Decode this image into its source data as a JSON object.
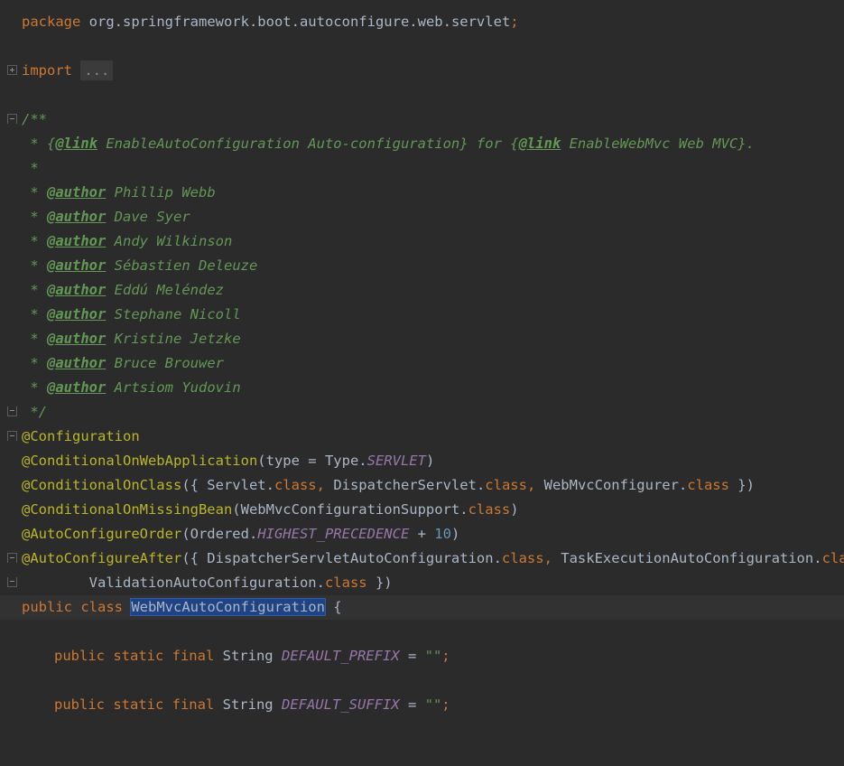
{
  "editor": {
    "package_keyword": "package",
    "package_name": "org.springframework.boot.autoconfigure.web.servlet",
    "semicolon": ";",
    "import_keyword": "import",
    "import_folded": "...",
    "javadoc": {
      "open": "/**",
      "line1_prefix": " * {",
      "line1_link1": "@link",
      "line1_text1": " EnableAutoConfiguration Auto-configuration} for {",
      "line1_link2": "@link",
      "line1_text2": " EnableWebMvc Web MVC}.",
      "blank": " *",
      "author_tag": "@author",
      "star": " * ",
      "authors": [
        "Phillip Webb",
        "Dave Syer",
        "Andy Wilkinson",
        "Sébastien Deleuze",
        "Eddú Meléndez",
        "Stephane Nicoll",
        "Kristine Jetzke",
        "Bruce Brouwer",
        "Artsiom Yudovin"
      ],
      "close": " */"
    },
    "annotations": {
      "configuration": "@Configuration",
      "on_web_app": "@ConditionalOnWebApplication",
      "on_web_app_args_a": "(type = Type.",
      "on_web_app_const": "SERVLET",
      "on_web_app_args_b": ")",
      "on_class": "@ConditionalOnClass",
      "on_class_a": "({ Servlet.",
      "on_class_b": " DispatcherServlet.",
      "on_class_c": " WebMvcConfigurer.",
      "on_class_end": " })",
      "class_kw": "class",
      "comma": ",",
      "on_missing": "@ConditionalOnMissingBean",
      "on_missing_a": "(WebMvcConfigurationSupport.",
      "on_missing_end": ")",
      "order": "@AutoConfigureOrder",
      "order_a": "(Ordered.",
      "order_const": "HIGHEST_PRECEDENCE",
      "order_b": " + ",
      "order_num": "10",
      "order_end": ")",
      "after": "@AutoConfigureAfter",
      "after_a": "({ DispatcherServletAutoConfiguration.",
      "after_b": " TaskExecutionAutoConfiguration.",
      "after_cont": "        ValidationAutoConfiguration.",
      "after_end": " })"
    },
    "class_decl": {
      "public_class": "public class ",
      "name": "WebMvcAutoConfiguration",
      "brace": " {"
    },
    "fields": [
      {
        "mods": "public static final ",
        "type": "String ",
        "name": "DEFAULT_PREFIX",
        "eq": " = ",
        "value": "\"\"",
        "end": ";"
      },
      {
        "mods": "public static final ",
        "type": "String ",
        "name": "DEFAULT_SUFFIX",
        "eq": " = ",
        "value": "\"\"",
        "end": ";"
      }
    ]
  }
}
